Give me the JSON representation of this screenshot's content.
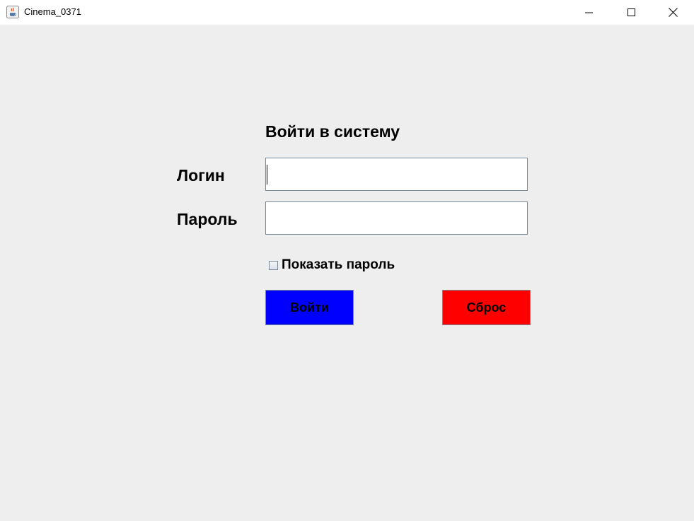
{
  "window": {
    "title": "Cinema_0371",
    "icon": "java-cup-icon",
    "controls": {
      "minimize_icon": "minimize-icon",
      "maximize_icon": "maximize-icon",
      "close_icon": "close-icon"
    }
  },
  "form": {
    "title": "Войти в систему",
    "login_label": "Логин",
    "login_value": "",
    "password_label": "Пароль",
    "password_value": "",
    "show_password_label": "Показать пароль",
    "show_password_checked": false,
    "login_button": "Войти",
    "reset_button": "Сброс"
  },
  "colors": {
    "background": "#eeeeee",
    "login_button": "#0000ff",
    "reset_button": "#ff0000"
  }
}
